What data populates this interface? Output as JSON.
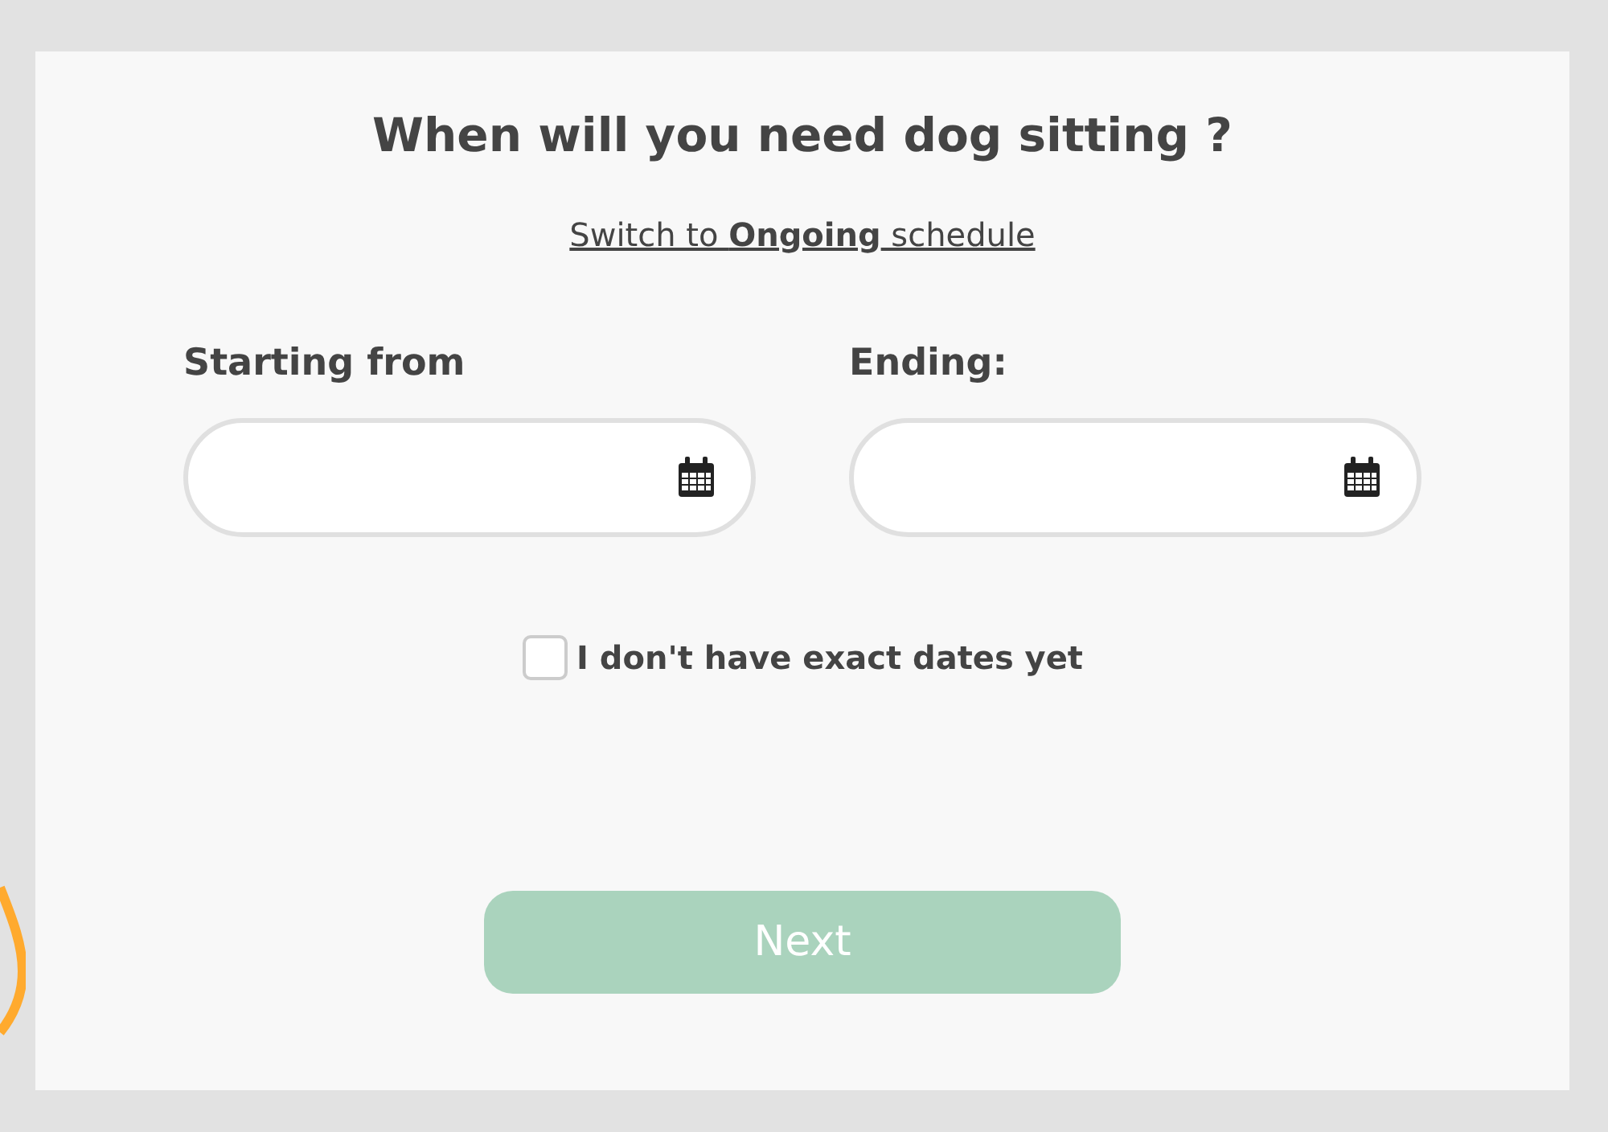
{
  "title": "When will you need dog sitting ?",
  "switch_link": "Switch to **Ongoing** schedule",
  "fields": [
    {
      "label": "Starting from"
    },
    {
      "label": "Ending:"
    }
  ],
  "no_exact_dates": {
    "label": "I don't have exact dates yet",
    "checked": false
  },
  "next_button": {
    "label": "Next",
    "disabled": true
  }
}
